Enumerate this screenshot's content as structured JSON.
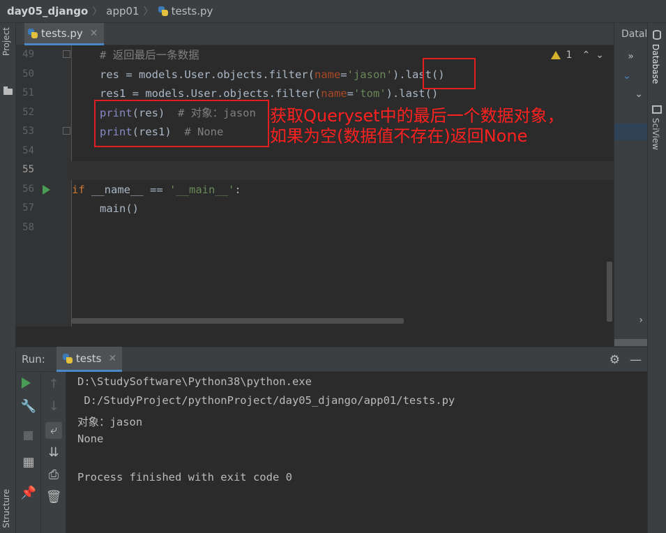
{
  "breadcrumb": {
    "project": "day05_django",
    "folder": "app01",
    "file": "tests.py"
  },
  "sidebar": {
    "project_label": "Project",
    "structure_label": "Structure"
  },
  "editor": {
    "tab_label": "tests.py",
    "inspection": {
      "warning_count": "1"
    },
    "line_numbers": [
      "49",
      "50",
      "51",
      "52",
      "53",
      "54",
      "55",
      "56",
      "57",
      "58"
    ],
    "lines": {
      "l49": "# 返回最后一条数据",
      "l50_a": "res = models.User.objects.filter(",
      "l50_param": "name",
      "l50_eq": "=",
      "l50_str": "'jason'",
      "l50_b": ").last()",
      "l51_a": "res1 = models.User.objects.filter(",
      "l51_param": "name",
      "l51_eq": "=",
      "l51_str": "'tom'",
      "l51_b": ").last()",
      "l52_fn": "print",
      "l52_args": "(res)",
      "l52_cm": "# 对象：jason",
      "l53_fn": "print",
      "l53_args": "(res1)",
      "l53_cm": "# None",
      "l56_kw": "if",
      "l56_mid": " __name__ == ",
      "l56_str": "'__main__'",
      "l56_end": ":",
      "l57": "main()"
    }
  },
  "annotation": {
    "text": "获取Queryset中的最后一个数据对象，\n如果为空(数据值不存在)返回None",
    "color": "#ff2020"
  },
  "db_panel": {
    "title": "Datal",
    "row1": "»",
    "row2": "⌄",
    "row3": "⌄"
  },
  "right_strip": {
    "database_label": "Database",
    "sciview_label": "SciView"
  },
  "run": {
    "label": "Run:",
    "tab_label": "tests",
    "output": [
      "D:\\StudySoftware\\Python38\\python.exe",
      " D:/StudyProject/pythonProject/day05_django/app01/tests.py",
      "对象：jason",
      "None",
      "",
      "Process finished with exit code 0"
    ]
  },
  "colors": {
    "accent": "#4a88c7",
    "run_green": "#499c54",
    "annotation_red": "#e31e1e"
  }
}
